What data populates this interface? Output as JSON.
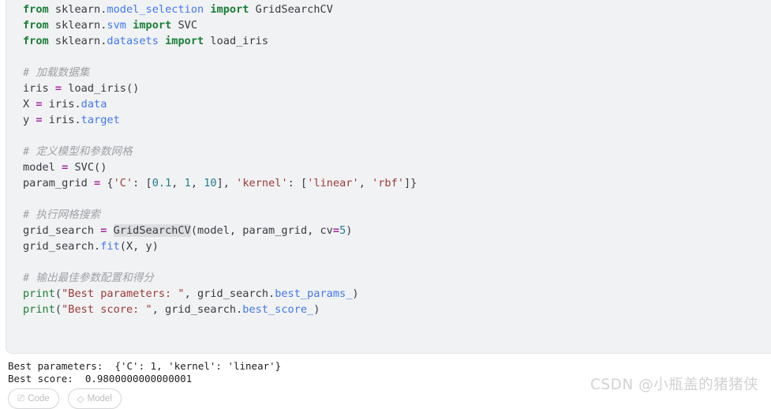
{
  "code_block": {
    "language": "python",
    "background": "#f1f2f3",
    "highlighted_token": "GridSearchCV",
    "lines": [
      {
        "id": 1,
        "text": "from sklearn.model_selection import GridSearchCV"
      },
      {
        "id": 2,
        "text": "from sklearn.svm import SVC"
      },
      {
        "id": 3,
        "text": "from sklearn.datasets import load_iris"
      },
      {
        "id": 4,
        "text": ""
      },
      {
        "id": 5,
        "text": "# 加载数据集"
      },
      {
        "id": 6,
        "text": "iris = load_iris()"
      },
      {
        "id": 7,
        "text": "X = iris.data"
      },
      {
        "id": 8,
        "text": "y = iris.target"
      },
      {
        "id": 9,
        "text": ""
      },
      {
        "id": 10,
        "text": "# 定义模型和参数网格"
      },
      {
        "id": 11,
        "text": "model = SVC()"
      },
      {
        "id": 12,
        "text": "param_grid = {'C': [0.1, 1, 10], 'kernel': ['linear', 'rbf']}"
      },
      {
        "id": 13,
        "text": ""
      },
      {
        "id": 14,
        "text": "# 执行网格搜索"
      },
      {
        "id": 15,
        "text": "grid_search = GridSearchCV(model, param_grid, cv=5)"
      },
      {
        "id": 16,
        "text": "grid_search.fit(X, y)"
      },
      {
        "id": 17,
        "text": ""
      },
      {
        "id": 18,
        "text": "# 输出最佳参数配置和得分"
      },
      {
        "id": 19,
        "text": "print(\"Best parameters: \", grid_search.best_params_)"
      },
      {
        "id": 20,
        "text": "print(\"Best score: \", grid_search.best_score_)"
      }
    ],
    "tokens": {
      "l1": [
        {
          "t": "from",
          "c": "kw"
        },
        {
          "t": " sklearn.",
          "c": "plain"
        },
        {
          "t": "model_selection",
          "c": "attr"
        },
        {
          "t": " ",
          "c": "plain"
        },
        {
          "t": "import",
          "c": "kw"
        },
        {
          "t": " GridSearchCV",
          "c": "plain"
        }
      ],
      "l2": [
        {
          "t": "from",
          "c": "kw"
        },
        {
          "t": " sklearn.",
          "c": "plain"
        },
        {
          "t": "svm",
          "c": "attr"
        },
        {
          "t": " ",
          "c": "plain"
        },
        {
          "t": "import",
          "c": "kw"
        },
        {
          "t": " SVC",
          "c": "plain"
        }
      ],
      "l3": [
        {
          "t": "from",
          "c": "kw"
        },
        {
          "t": " sklearn.",
          "c": "plain"
        },
        {
          "t": "datasets",
          "c": "attr"
        },
        {
          "t": " ",
          "c": "plain"
        },
        {
          "t": "import",
          "c": "kw"
        },
        {
          "t": " load_iris",
          "c": "plain"
        }
      ],
      "l5": [
        {
          "t": "# 加载数据集",
          "c": "com"
        }
      ],
      "l6": [
        {
          "t": "iris ",
          "c": "plain"
        },
        {
          "t": "=",
          "c": "op"
        },
        {
          "t": " load_iris()",
          "c": "plain"
        }
      ],
      "l7": [
        {
          "t": "X ",
          "c": "plain"
        },
        {
          "t": "=",
          "c": "op"
        },
        {
          "t": " iris.",
          "c": "plain"
        },
        {
          "t": "data",
          "c": "attr"
        }
      ],
      "l8": [
        {
          "t": "y ",
          "c": "plain"
        },
        {
          "t": "=",
          "c": "op"
        },
        {
          "t": " iris.",
          "c": "plain"
        },
        {
          "t": "target",
          "c": "attr"
        }
      ],
      "l10": [
        {
          "t": "# 定义模型和参数网格",
          "c": "com"
        }
      ],
      "l11": [
        {
          "t": "model ",
          "c": "plain"
        },
        {
          "t": "=",
          "c": "op"
        },
        {
          "t": " SVC()",
          "c": "plain"
        }
      ],
      "l12": [
        {
          "t": "param_grid ",
          "c": "plain"
        },
        {
          "t": "=",
          "c": "op"
        },
        {
          "t": " {",
          "c": "plain"
        },
        {
          "t": "'C'",
          "c": "str"
        },
        {
          "t": ": [",
          "c": "plain"
        },
        {
          "t": "0.1",
          "c": "num"
        },
        {
          "t": ", ",
          "c": "plain"
        },
        {
          "t": "1",
          "c": "num"
        },
        {
          "t": ", ",
          "c": "plain"
        },
        {
          "t": "10",
          "c": "num"
        },
        {
          "t": "], ",
          "c": "plain"
        },
        {
          "t": "'kernel'",
          "c": "str"
        },
        {
          "t": ": [",
          "c": "plain"
        },
        {
          "t": "'linear'",
          "c": "str"
        },
        {
          "t": ", ",
          "c": "plain"
        },
        {
          "t": "'rbf'",
          "c": "str"
        },
        {
          "t": "]}",
          "c": "plain"
        }
      ],
      "l14": [
        {
          "t": "# 执行网格搜索",
          "c": "com"
        }
      ],
      "l15": [
        {
          "t": "grid_search ",
          "c": "plain"
        },
        {
          "t": "=",
          "c": "op"
        },
        {
          "t": " ",
          "c": "plain"
        },
        {
          "t": "GridSearchCV",
          "c": "plain hl"
        },
        {
          "t": "(model, param_grid, cv",
          "c": "plain"
        },
        {
          "t": "=",
          "c": "op"
        },
        {
          "t": "5",
          "c": "num"
        },
        {
          "t": ")",
          "c": "plain"
        }
      ],
      "l16": [
        {
          "t": "grid_search.",
          "c": "plain"
        },
        {
          "t": "fit",
          "c": "attr"
        },
        {
          "t": "(X, y)",
          "c": "plain"
        }
      ],
      "l18": [
        {
          "t": "# 输出最佳参数配置和得分",
          "c": "com"
        }
      ],
      "l19": [
        {
          "t": "print",
          "c": "fn"
        },
        {
          "t": "(",
          "c": "plain"
        },
        {
          "t": "\"Best parameters: \"",
          "c": "str"
        },
        {
          "t": ", grid_search.",
          "c": "plain"
        },
        {
          "t": "best_params_",
          "c": "attr"
        },
        {
          "t": ")",
          "c": "plain"
        }
      ],
      "l20": [
        {
          "t": "print",
          "c": "fn"
        },
        {
          "t": "(",
          "c": "plain"
        },
        {
          "t": "\"Best score: \"",
          "c": "str"
        },
        {
          "t": ", grid_search.",
          "c": "plain"
        },
        {
          "t": "best_score_",
          "c": "attr"
        },
        {
          "t": ")",
          "c": "plain"
        }
      ]
    }
  },
  "output": {
    "line_1": "Best parameters:  {'C': 1, 'kernel': 'linear'}",
    "line_2": "Best score:  0.9800000000000001",
    "best_parameters": {
      "C": 1,
      "kernel": "linear"
    },
    "best_score": "0.9800000000000001"
  },
  "bottom_buttons": [
    {
      "icon": "copy-icon",
      "label": "Code"
    },
    {
      "icon": "cube-icon",
      "label": "Model"
    }
  ],
  "watermark": {
    "text": "CSDN @小瓶盖的猪猪侠",
    "color": "#d2d2d4"
  }
}
